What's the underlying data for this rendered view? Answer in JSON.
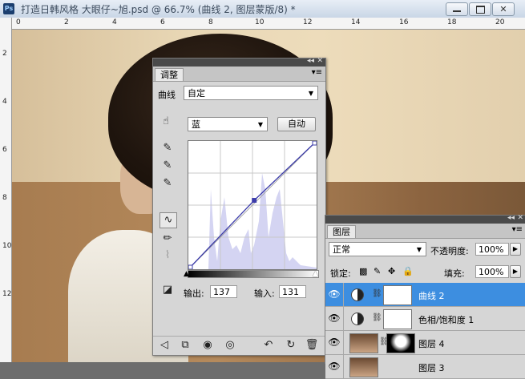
{
  "window": {
    "app_icon": "Ps",
    "title": "打造日韩风格 大眼仔~旭.psd @ 66.7% (曲线 2, 图层蒙版/8) *",
    "buttons": [
      "minimize-icon",
      "restore-icon",
      "close-icon"
    ]
  },
  "ruler_top": [
    "0",
    "2",
    "4",
    "6",
    "8",
    "10",
    "12",
    "14",
    "16",
    "18",
    "20"
  ],
  "ruler_left": [
    "2",
    "4",
    "6",
    "8",
    "10",
    "12"
  ],
  "adjustments": {
    "tab_label": "调整",
    "preset_label": "曲线",
    "preset_value": "自定",
    "channel_value": "蓝",
    "auto_button": "自动",
    "output_label": "输出:",
    "output_value": "137",
    "input_label": "输入:",
    "input_value": "131",
    "curve_points": [
      [
        0,
        0
      ],
      [
        131,
        137
      ],
      [
        255,
        255
      ]
    ]
  },
  "layers": {
    "tab_label": "图层",
    "blend_mode": "正常",
    "opacity_label": "不透明度:",
    "opacity_value": "100%",
    "lock_label": "锁定:",
    "fill_label": "填充:",
    "fill_value": "100%",
    "rows": [
      {
        "name": "曲线 2",
        "active": true
      },
      {
        "name": "色相/饱和度 1",
        "active": false
      },
      {
        "name": "图层 4",
        "active": false
      },
      {
        "name": "图层 3",
        "active": false
      }
    ]
  },
  "colors": {
    "selection": "#3d8ee0",
    "curve_line": "#3c3caa",
    "histogram": "#d4d4f2"
  }
}
